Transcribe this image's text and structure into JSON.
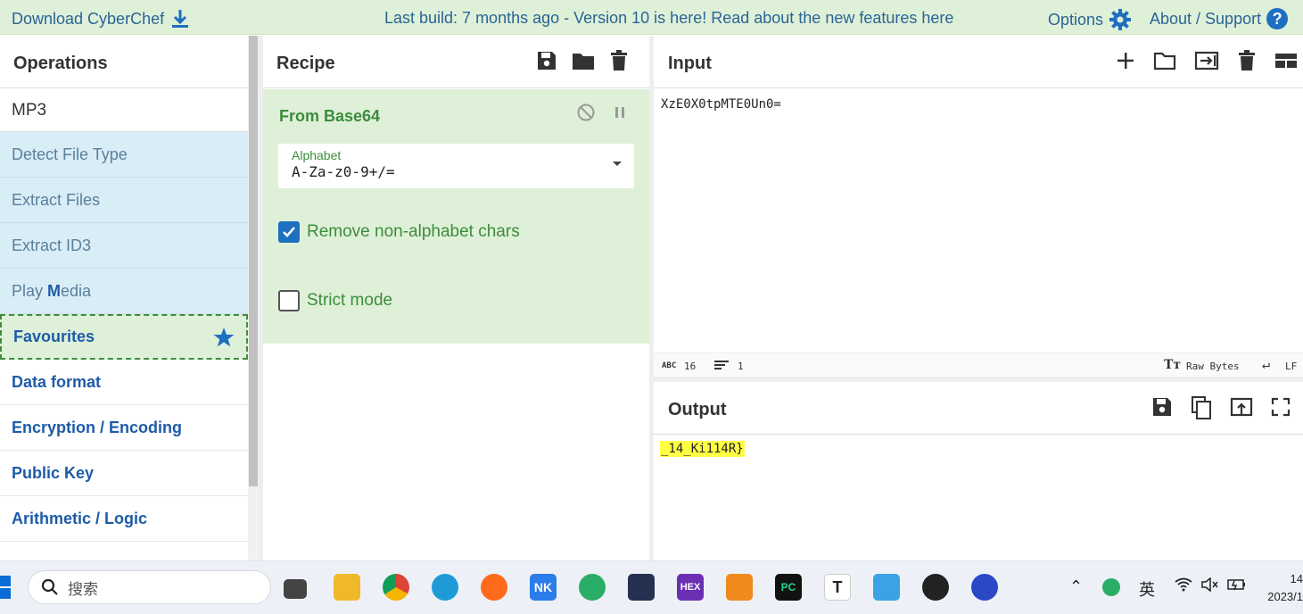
{
  "banner": {
    "download": "Download CyberChef",
    "notice": "Last build: 7 months ago - Version 10 is here! Read about the new features here",
    "options": "Options",
    "about": "About / Support",
    "about_icon_text": "?"
  },
  "operations": {
    "title": "Operations",
    "search_value": "MP3",
    "results": [
      "Detect File Type",
      "Extract Files",
      "Extract ID3"
    ],
    "play_media": {
      "before": "Play ",
      "match": "M",
      "after": "edia"
    },
    "categories": [
      "Favourites",
      "Data format",
      "Encryption / Encoding",
      "Public Key",
      "Arithmetic / Logic"
    ]
  },
  "recipe": {
    "title": "Recipe",
    "operation": {
      "name": "From Base64",
      "alphabet_label": "Alphabet",
      "alphabet_value": "A-Za-z0-9+/=",
      "remove_non_alphabet": {
        "label": "Remove non-alphabet chars",
        "checked": true
      },
      "strict_mode": {
        "label": "Strict mode",
        "checked": false
      }
    }
  },
  "input": {
    "title": "Input",
    "text": "XzE0X0tpMTE0Un0=",
    "status": {
      "length": "16",
      "lines": "1",
      "encoding": "Raw Bytes",
      "eol": "LF"
    }
  },
  "output": {
    "title": "Output",
    "text": "_14_Ki114R}"
  },
  "taskbar": {
    "search_placeholder": "搜索",
    "ime": "英",
    "clock_time": "14",
    "clock_date": "2023/1"
  },
  "colors": {
    "banner_bg": "#dff0d8",
    "link": "#2a6496",
    "operation_result_bg": "#d9edf7",
    "category_text": "#1e5ba8",
    "recipe_op_bg": "#dff0d8",
    "output_highlight": "#ffff44"
  }
}
